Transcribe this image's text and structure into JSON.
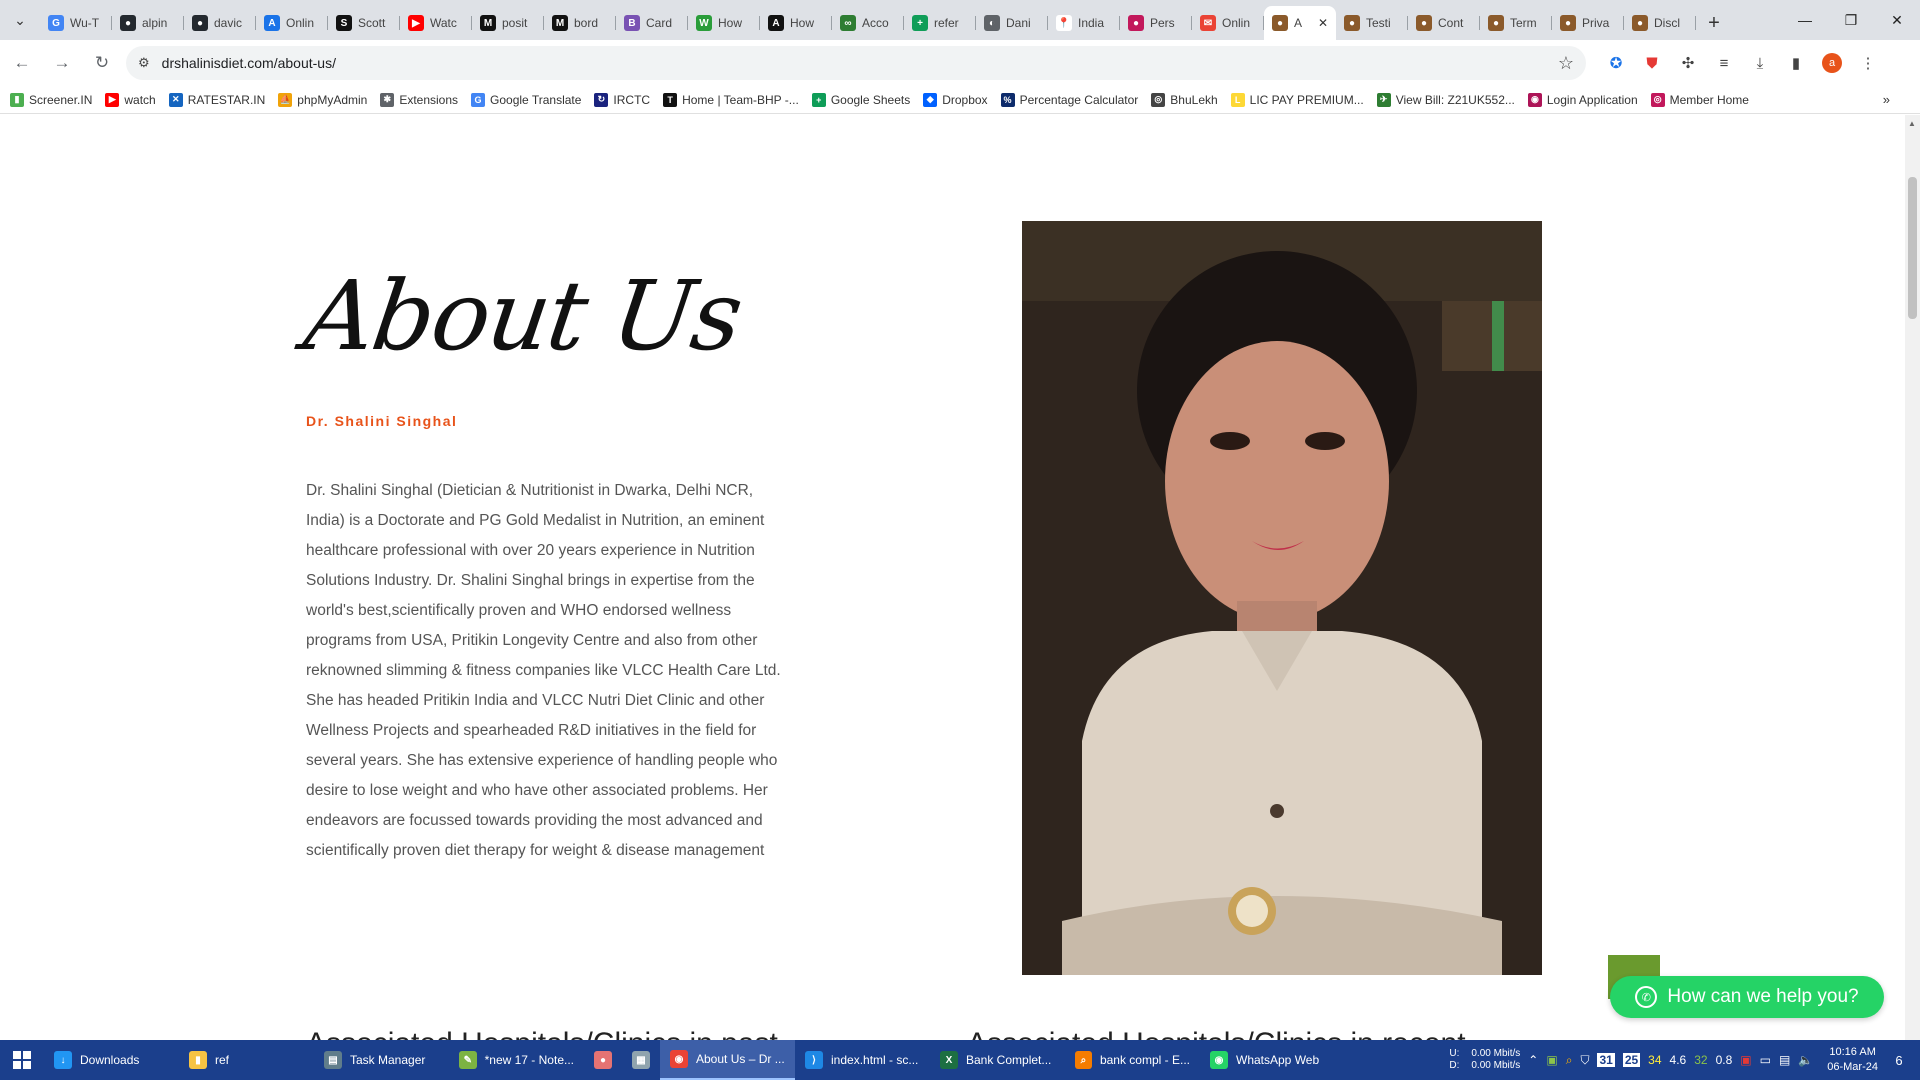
{
  "browser": {
    "tabs": [
      {
        "label": "Wu-T",
        "icon": "google-icon",
        "color": "#4285f4",
        "glyph": "G"
      },
      {
        "label": "alpin",
        "icon": "github-icon",
        "color": "#24292f",
        "glyph": "●"
      },
      {
        "label": "davic",
        "icon": "github-icon",
        "color": "#24292f",
        "glyph": "●"
      },
      {
        "label": "Onlin",
        "icon": "globe-icon",
        "color": "#1a73e8",
        "glyph": "A"
      },
      {
        "label": "Scott",
        "icon": "scott-icon",
        "color": "#111111",
        "glyph": "S"
      },
      {
        "label": "Watc",
        "icon": "youtube-icon",
        "color": "#ff0000",
        "glyph": "▶"
      },
      {
        "label": "posit",
        "icon": "medium-icon",
        "color": "#111111",
        "glyph": "M"
      },
      {
        "label": "bord",
        "icon": "medium-icon",
        "color": "#111111",
        "glyph": "M"
      },
      {
        "label": "Card",
        "icon": "bootstrap-icon",
        "color": "#7952b3",
        "glyph": "B"
      },
      {
        "label": "How",
        "icon": "wiki-icon",
        "color": "#2a9d3a",
        "glyph": "W"
      },
      {
        "label": "How",
        "icon": "article-icon",
        "color": "#111111",
        "glyph": "A"
      },
      {
        "label": "Acco",
        "icon": "link-icon",
        "color": "#2e7d32",
        "glyph": "∞"
      },
      {
        "label": "refer",
        "icon": "sheets-icon",
        "color": "#0f9d58",
        "glyph": "+"
      },
      {
        "label": "Dani",
        "icon": "circle-icon",
        "color": "#5f6368",
        "glyph": "◐"
      },
      {
        "label": "India",
        "icon": "maps-icon",
        "color": "#ffffff",
        "glyph": "📍"
      },
      {
        "label": "Pers",
        "icon": "chart-icon",
        "color": "#c2185b",
        "glyph": "●"
      },
      {
        "label": "Onlin",
        "icon": "gmail-icon",
        "color": "#ea4335",
        "glyph": "✉"
      },
      {
        "label": "A",
        "icon": "site-icon",
        "color": "#8b5a2b",
        "glyph": "●"
      },
      {
        "label": "Testi",
        "icon": "site-icon",
        "color": "#8b5a2b",
        "glyph": "●"
      },
      {
        "label": "Cont",
        "icon": "site-icon",
        "color": "#8b5a2b",
        "glyph": "●"
      },
      {
        "label": "Term",
        "icon": "site-icon",
        "color": "#8b5a2b",
        "glyph": "●"
      },
      {
        "label": "Priva",
        "icon": "site-icon",
        "color": "#8b5a2b",
        "glyph": "●"
      },
      {
        "label": "Discl",
        "icon": "site-icon",
        "color": "#8b5a2b",
        "glyph": "●"
      }
    ],
    "active_tab_index": 17,
    "url": "drshalinisdiet.com/about-us/",
    "bookmarks": [
      {
        "label": "Screener.IN",
        "color": "#4caf50",
        "glyph": "▮"
      },
      {
        "label": "watch",
        "color": "#ff0000",
        "glyph": "▶"
      },
      {
        "label": "RATESTAR.IN",
        "color": "#1565c0",
        "glyph": "✕"
      },
      {
        "label": "phpMyAdmin",
        "color": "#f0a30a",
        "glyph": "⛵"
      },
      {
        "label": "Extensions",
        "color": "#5f6368",
        "glyph": "✱"
      },
      {
        "label": "Google Translate",
        "color": "#4285f4",
        "glyph": "G"
      },
      {
        "label": "IRCTC",
        "color": "#1a237e",
        "glyph": "↻"
      },
      {
        "label": "Home | Team-BHP -...",
        "color": "#111111",
        "glyph": "T"
      },
      {
        "label": "Google Sheets",
        "color": "#0f9d58",
        "glyph": "+"
      },
      {
        "label": "Dropbox",
        "color": "#0061ff",
        "glyph": "◆"
      },
      {
        "label": "Percentage Calculator",
        "color": "#0d2b6b",
        "glyph": "%"
      },
      {
        "label": "BhuLekh",
        "color": "#444444",
        "glyph": "◎"
      },
      {
        "label": "LIC PAY PREMIUM...",
        "color": "#fdd835",
        "glyph": "L"
      },
      {
        "label": "View Bill: Z21UK552...",
        "color": "#2e7d32",
        "glyph": "✈"
      },
      {
        "label": "Login Application",
        "color": "#ad1457",
        "glyph": "◉"
      },
      {
        "label": "Member Home",
        "color": "#c2185b",
        "glyph": "◎"
      }
    ]
  },
  "page": {
    "heading": "About Us",
    "subheading": "Dr. Shalini Singhal",
    "bio": "Dr. Shalini Singhal (Dietician & Nutritionist in Dwarka, Delhi NCR, India) is a Doctorate and PG Gold Medalist in Nutrition, an eminent healthcare professional with over 20 years experience in Nutrition Solutions Industry. Dr. Shalini Singhal brings in expertise from the world's best,scientifically proven and WHO endorsed wellness programs from USA, Pritikin Longevity Centre and also from other reknowned slimming & fitness companies like VLCC Health Care Ltd. She has headed Pritikin India and VLCC Nutri Diet Clinic and other Wellness Projects and spearheaded R&D initiatives in the field for several years. She has extensive experience of handling people who desire to lose weight and who have other associated problems. Her endeavors are focussed towards providing the most advanced and scientifically proven diet therapy for weight & disease management",
    "cut_left": "Associated Hospitals/Clinics in past",
    "cut_right": "Associated Hospitals/Clinics in recent",
    "whatsapp_label": "How can we help you?",
    "accent_color": "#e8531a",
    "whatsapp_color": "#25d366"
  },
  "taskbar": {
    "items": [
      {
        "label": "Downloads",
        "icon": "download-icon",
        "color": "#2196f3",
        "glyph": "↓",
        "active": false
      },
      {
        "label": "ref",
        "icon": "folder-icon",
        "color": "#f6c343",
        "glyph": "▮",
        "active": false
      },
      {
        "label": "Task Manager",
        "icon": "task-manager-icon",
        "color": "#607d8b",
        "glyph": "▤",
        "active": false
      },
      {
        "label": "*new 17 - Note...",
        "icon": "notepad-icon",
        "color": "#7cb342",
        "glyph": "✎",
        "active": false
      },
      {
        "label": "",
        "icon": "app-icon",
        "color": "#e57373",
        "glyph": "●",
        "active": false
      },
      {
        "label": "",
        "icon": "calculator-icon",
        "color": "#90a4ae",
        "glyph": "▦",
        "active": false
      },
      {
        "label": "About Us – Dr ...",
        "icon": "chrome-icon",
        "color": "#ea4335",
        "glyph": "◉",
        "active": true
      },
      {
        "label": "index.html - sc...",
        "icon": "vscode-icon",
        "color": "#1e88e5",
        "glyph": "⟩",
        "active": false
      },
      {
        "label": "Bank Complet...",
        "icon": "excel-icon",
        "color": "#1d6f42",
        "glyph": "X",
        "active": false
      },
      {
        "label": "bank compl - E...",
        "icon": "search-icon",
        "color": "#f57c00",
        "glyph": "⌕",
        "active": false
      },
      {
        "label": "WhatsApp Web",
        "icon": "whatsapp-icon",
        "color": "#25d366",
        "glyph": "◉",
        "active": false
      }
    ],
    "net_up_label": "U:",
    "net_down_label": "D:",
    "net_up": "0.00 Mbit/s",
    "net_down": "0.00 Mbit/s",
    "tray_numbers": [
      "31",
      "25",
      "34",
      "4.6",
      "32",
      "0.8"
    ],
    "time": "10:16 AM",
    "date": "06-Mar-24",
    "notifications": "6"
  }
}
